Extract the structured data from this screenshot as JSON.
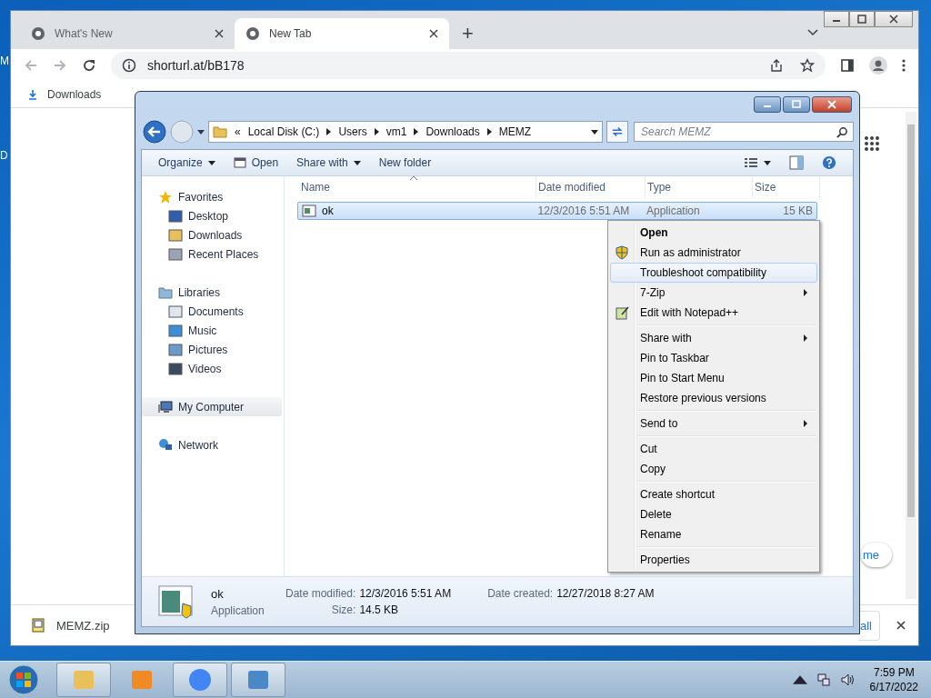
{
  "desktop": {
    "icon_labels": [
      "M",
      "D"
    ]
  },
  "browser": {
    "tabs": [
      {
        "title": "What's New",
        "selected": false
      },
      {
        "title": "New Tab",
        "selected": true
      }
    ],
    "new_tab_button": "+",
    "url": "shorturl.at/bB178",
    "bookmarks": [
      "Downloads"
    ],
    "page": {
      "partial_button": "me"
    },
    "download_shelf": {
      "items": [
        "MEMZ.zip"
      ],
      "show_all": "all"
    }
  },
  "explorer": {
    "overflow": "«",
    "breadcrumb": [
      "Local Disk (C:)",
      "Users",
      "vm1",
      "Downloads",
      "MEMZ"
    ],
    "search": {
      "placeholder": "Search MEMZ"
    },
    "commands": [
      {
        "label": "Organize",
        "dropdown": true
      },
      {
        "label": "Open",
        "dropdown": false
      },
      {
        "label": "Share with",
        "dropdown": true
      },
      {
        "label": "New folder",
        "dropdown": false
      }
    ],
    "nav": [
      {
        "label": "Favorites",
        "selected": false,
        "children": [
          {
            "label": "Desktop",
            "selected": false
          },
          {
            "label": "Downloads",
            "selected": false
          },
          {
            "label": "Recent Places",
            "selected": false
          }
        ]
      },
      {
        "label": "Libraries",
        "selected": false,
        "children": [
          {
            "label": "Documents",
            "selected": false
          },
          {
            "label": "Music",
            "selected": false
          },
          {
            "label": "Pictures",
            "selected": false
          },
          {
            "label": "Videos",
            "selected": false
          }
        ]
      },
      {
        "label": "My Computer",
        "selected": true
      },
      {
        "label": "Network",
        "selected": false
      }
    ],
    "columns": [
      "Name",
      "Date modified",
      "Type",
      "Size"
    ],
    "files": [
      {
        "name": "ok",
        "date_modified": "12/3/2016 5:51 AM",
        "type": "Application",
        "size": "15 KB",
        "selected": true
      }
    ],
    "details": {
      "name": "ok",
      "type": "Application",
      "fields": [
        {
          "label": "Date modified:",
          "value": "12/3/2016 5:51 AM"
        },
        {
          "label": "Date created:",
          "value": "12/27/2018 8:27 AM"
        },
        {
          "label": "Size:",
          "value": "14.5 KB"
        }
      ]
    }
  },
  "context_menu": {
    "groups": [
      [
        {
          "label": "Open",
          "default": true,
          "selected": false,
          "submenu": false,
          "kind": "plain"
        },
        {
          "label": "Run as administrator",
          "default": false,
          "selected": false,
          "submenu": false,
          "kind": "shield"
        },
        {
          "label": "Troubleshoot compatibility",
          "default": false,
          "selected": true,
          "submenu": false,
          "kind": "plain"
        },
        {
          "label": "7-Zip",
          "default": false,
          "selected": false,
          "submenu": true,
          "kind": "plain"
        },
        {
          "label": "Edit with Notepad++",
          "default": false,
          "selected": false,
          "submenu": false,
          "kind": "notepad"
        }
      ],
      [
        {
          "label": "Share with",
          "default": false,
          "selected": false,
          "submenu": true,
          "kind": "plain"
        },
        {
          "label": "Pin to Taskbar",
          "default": false,
          "selected": false,
          "submenu": false,
          "kind": "plain"
        },
        {
          "label": "Pin to Start Menu",
          "default": false,
          "selected": false,
          "submenu": false,
          "kind": "plain"
        },
        {
          "label": "Restore previous versions",
          "default": false,
          "selected": false,
          "submenu": false,
          "kind": "plain"
        }
      ],
      [
        {
          "label": "Send to",
          "default": false,
          "selected": false,
          "submenu": true,
          "kind": "plain"
        }
      ],
      [
        {
          "label": "Cut",
          "default": false,
          "selected": false,
          "submenu": false,
          "kind": "plain"
        },
        {
          "label": "Copy",
          "default": false,
          "selected": false,
          "submenu": false,
          "kind": "plain"
        }
      ],
      [
        {
          "label": "Create shortcut",
          "default": false,
          "selected": false,
          "submenu": false,
          "kind": "plain"
        },
        {
          "label": "Delete",
          "default": false,
          "selected": false,
          "submenu": false,
          "kind": "plain"
        },
        {
          "label": "Rename",
          "default": false,
          "selected": false,
          "submenu": false,
          "kind": "plain"
        }
      ],
      [
        {
          "label": "Properties",
          "default": false,
          "selected": false,
          "submenu": false,
          "kind": "plain"
        }
      ]
    ]
  },
  "taskbar": {
    "buttons": [
      {
        "open": true
      },
      {
        "open": false
      },
      {
        "open": true
      },
      {
        "open": true
      }
    ],
    "time": "7:59 PM",
    "date": "6/17/2022"
  }
}
